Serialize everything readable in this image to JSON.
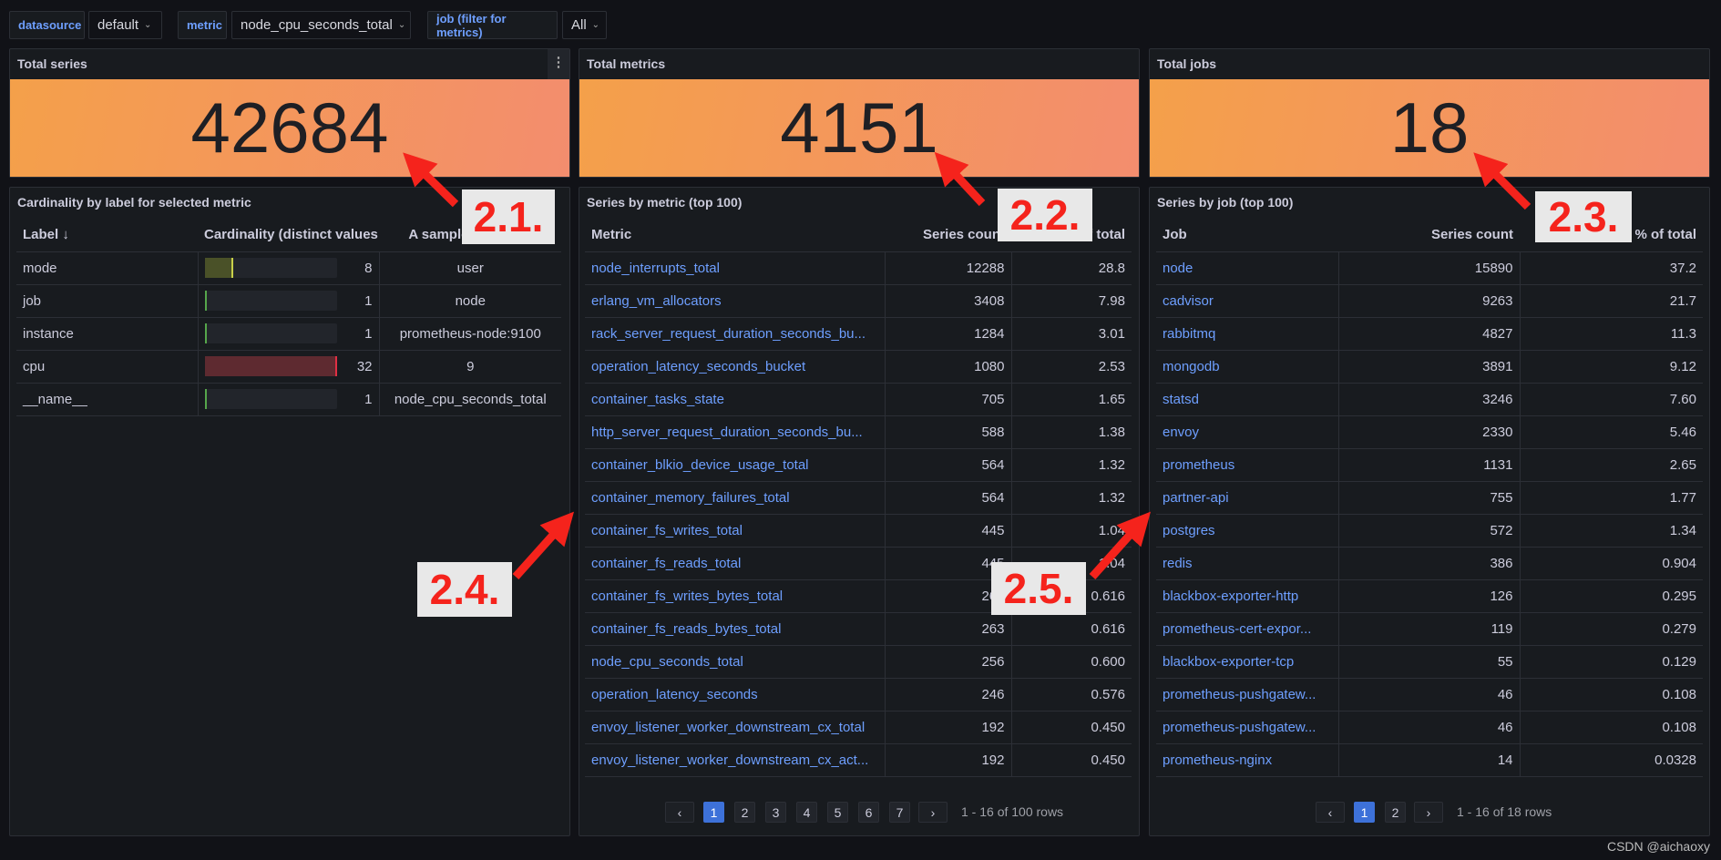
{
  "filters": {
    "datasource_label": "datasource",
    "datasource_value": "default",
    "metric_label": "metric",
    "metric_value": "node_cpu_seconds_total",
    "job_label": "job (filter for metrics)",
    "job_value": "All"
  },
  "stats": [
    {
      "title": "Total series",
      "value": "42684"
    },
    {
      "title": "Total metrics",
      "value": "4151"
    },
    {
      "title": "Total jobs",
      "value": "18"
    }
  ],
  "stat_color": "#f39a5a",
  "labels_panel": {
    "title": "Cardinality by label for selected metric",
    "headers": [
      "Label ↓",
      "Cardinality (distinct values",
      "A sample of values"
    ],
    "rows": [
      {
        "label": "mode",
        "cardinality": "8",
        "sample": "user",
        "fill": 0.22,
        "color": "#c8d04a",
        "bg": "#4a5128"
      },
      {
        "label": "job",
        "cardinality": "1",
        "sample": "node",
        "fill": 0,
        "color": "#56a64b",
        "bg": "#1f3a1d"
      },
      {
        "label": "instance",
        "cardinality": "1",
        "sample": "prometheus-node:9100",
        "fill": 0,
        "color": "#56a64b",
        "bg": "#1f3a1d"
      },
      {
        "label": "cpu",
        "cardinality": "32",
        "sample": "9",
        "fill": 1,
        "color": "#e02f44",
        "bg": "#5e2a30"
      },
      {
        "label": "__name__",
        "cardinality": "1",
        "sample": "node_cpu_seconds_total",
        "fill": 0,
        "color": "#56a64b",
        "bg": "#1f3a1d"
      }
    ]
  },
  "metrics_panel": {
    "title": "Series by metric (top 100)",
    "headers": [
      "Metric",
      "Series count",
      "% of total"
    ],
    "rows": [
      [
        "node_interrupts_total",
        "12288",
        "28.8"
      ],
      [
        "erlang_vm_allocators",
        "3408",
        "7.98"
      ],
      [
        "rack_server_request_duration_seconds_bu...",
        "1284",
        "3.01"
      ],
      [
        "operation_latency_seconds_bucket",
        "1080",
        "2.53"
      ],
      [
        "container_tasks_state",
        "705",
        "1.65"
      ],
      [
        "http_server_request_duration_seconds_bu...",
        "588",
        "1.38"
      ],
      [
        "container_blkio_device_usage_total",
        "564",
        "1.32"
      ],
      [
        "container_memory_failures_total",
        "564",
        "1.32"
      ],
      [
        "container_fs_writes_total",
        "445",
        "1.04"
      ],
      [
        "container_fs_reads_total",
        "445",
        "1.04"
      ],
      [
        "container_fs_writes_bytes_total",
        "263",
        "0.616"
      ],
      [
        "container_fs_reads_bytes_total",
        "263",
        "0.616"
      ],
      [
        "node_cpu_seconds_total",
        "256",
        "0.600"
      ],
      [
        "operation_latency_seconds",
        "246",
        "0.576"
      ],
      [
        "envoy_listener_worker_downstream_cx_total",
        "192",
        "0.450"
      ],
      [
        "envoy_listener_worker_downstream_cx_act...",
        "192",
        "0.450"
      ]
    ],
    "pages": [
      "1",
      "2",
      "3",
      "4",
      "5",
      "6",
      "7"
    ],
    "page_info": "1 - 16 of 100 rows"
  },
  "jobs_panel": {
    "title": "Series by job (top 100)",
    "headers": [
      "Job",
      "Series count",
      "% of total"
    ],
    "rows": [
      [
        "node",
        "15890",
        "37.2"
      ],
      [
        "cadvisor",
        "9263",
        "21.7"
      ],
      [
        "rabbitmq",
        "4827",
        "11.3"
      ],
      [
        "mongodb",
        "3891",
        "9.12"
      ],
      [
        "statsd",
        "3246",
        "7.60"
      ],
      [
        "envoy",
        "2330",
        "5.46"
      ],
      [
        "prometheus",
        "1131",
        "2.65"
      ],
      [
        "partner-api",
        "755",
        "1.77"
      ],
      [
        "postgres",
        "572",
        "1.34"
      ],
      [
        "redis",
        "386",
        "0.904"
      ],
      [
        "blackbox-exporter-http",
        "126",
        "0.295"
      ],
      [
        "prometheus-cert-expor...",
        "119",
        "0.279"
      ],
      [
        "blackbox-exporter-tcp",
        "55",
        "0.129"
      ],
      [
        "prometheus-pushgatew...",
        "46",
        "0.108"
      ],
      [
        "prometheus-pushgatew...",
        "46",
        "0.108"
      ],
      [
        "prometheus-nginx",
        "14",
        "0.0328"
      ]
    ],
    "pages": [
      "1",
      "2"
    ],
    "page_info": "1 - 16 of 18 rows"
  },
  "annotations": [
    "2.1.",
    "2.2.",
    "2.3.",
    "2.4.",
    "2.5."
  ],
  "watermark": "CSDN @aichaoxy"
}
